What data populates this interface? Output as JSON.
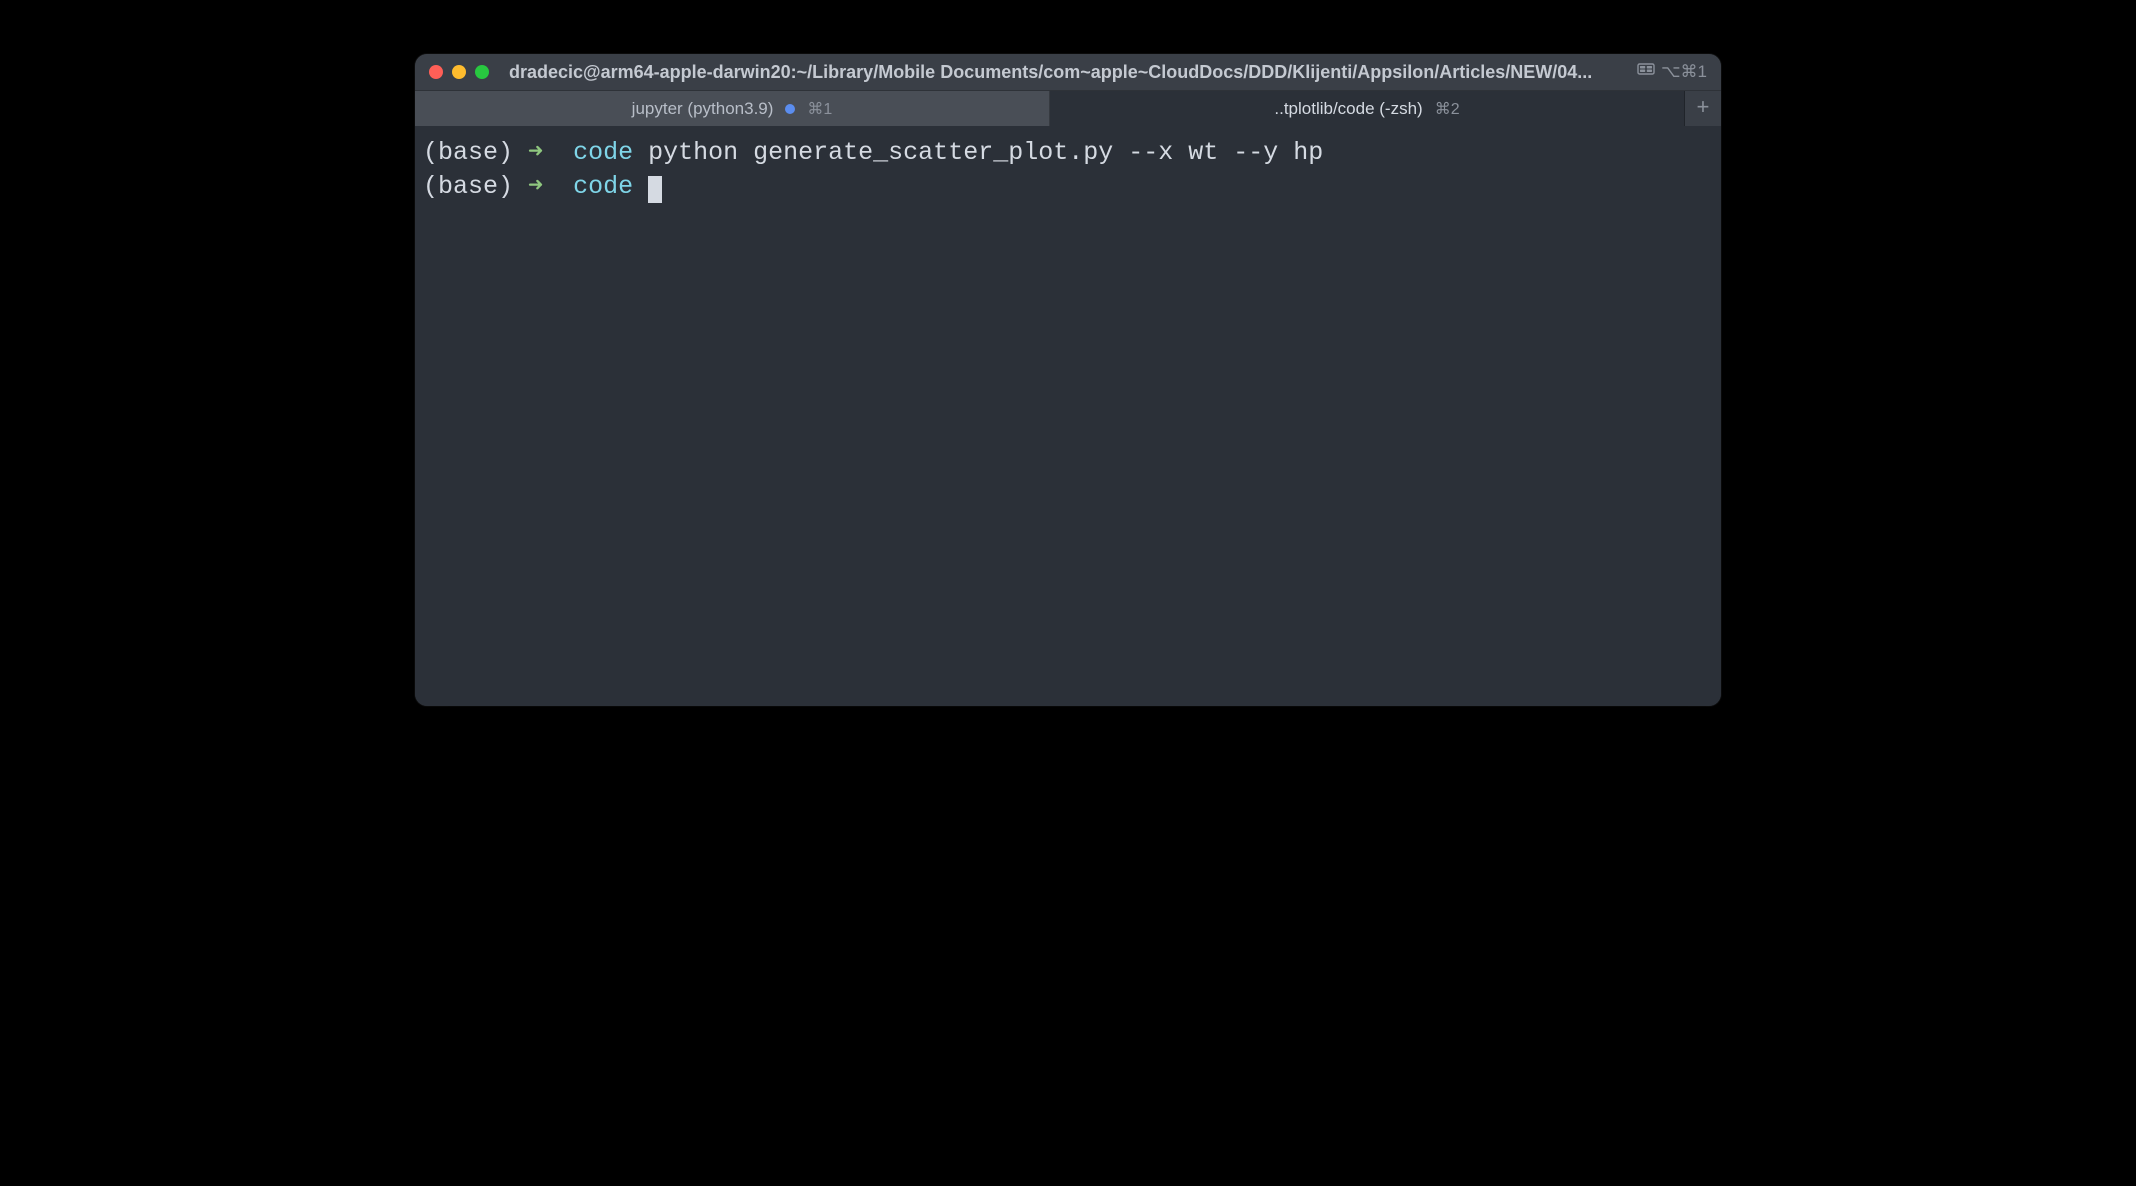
{
  "window": {
    "title": "dradecic@arm64-apple-darwin20:~/Library/Mobile Documents/com~apple~CloudDocs/DDD/Klijenti/Appsilon/Articles/NEW/04...",
    "broadcast_label": "⌥⌘1"
  },
  "tabs": [
    {
      "label": "jupyter (python3.9)",
      "shortcut": "⌘1",
      "has_indicator": true,
      "active": false
    },
    {
      "label": "..tplotlib/code (-zsh)",
      "shortcut": "⌘2",
      "has_indicator": false,
      "active": true
    }
  ],
  "terminal": {
    "lines": [
      {
        "env": "(base)",
        "arrow": "➜",
        "dir": "code",
        "command": "python generate_scatter_plot.py --x wt --y hp",
        "cursor": false
      },
      {
        "env": "(base)",
        "arrow": "➜",
        "dir": "code",
        "command": "",
        "cursor": true
      }
    ]
  }
}
